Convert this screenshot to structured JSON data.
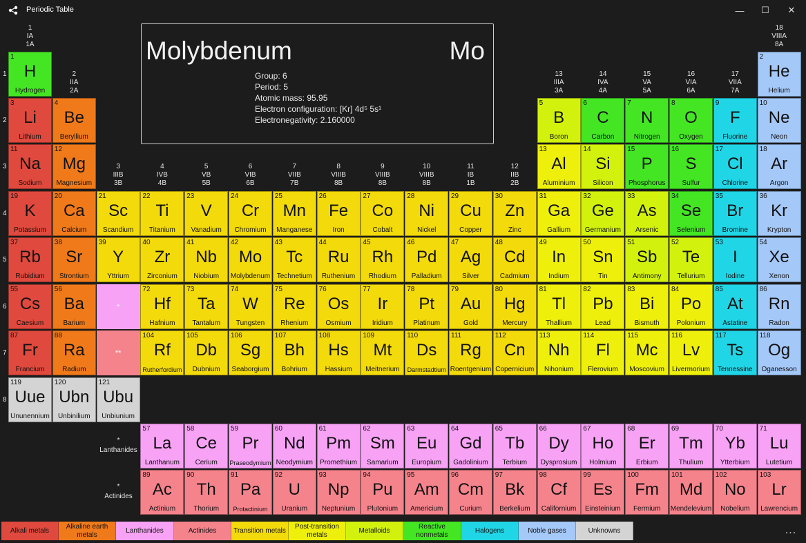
{
  "window": {
    "title": "Periodic Table",
    "minimize": "—",
    "maximize": "☐",
    "close": "✕",
    "icon": "share-nodes-icon"
  },
  "info": {
    "name": "Molybdenum",
    "symbol": "Mo",
    "lines": [
      "Group: 6",
      "Period: 5",
      "Atomic mass: 95.95",
      "Electron configuration: [Kr] 4d⁵ 5s¹",
      "Electronegativity: 2.160000"
    ]
  },
  "colors": {
    "alkali": "#e0493d",
    "alkaline": "#f07a1a",
    "lanthanide": "#f7a2f5",
    "actinide": "#f5838c",
    "transition": "#f3da0a",
    "post": "#eef00b",
    "metalloid": "#d2f20e",
    "nonmetal": "#44e624",
    "halogen": "#20d6e6",
    "noble": "#a4c8f8",
    "unknown": "#d4d4d4"
  },
  "group_headers": [
    [
      "1",
      "IA",
      "1A"
    ],
    [
      "2",
      "IIA",
      "2A"
    ],
    [
      "3",
      "IIIB",
      "3B"
    ],
    [
      "4",
      "IVB",
      "4B"
    ],
    [
      "5",
      "VB",
      "5B"
    ],
    [
      "6",
      "VIB",
      "6B"
    ],
    [
      "7",
      "VIIB",
      "7B"
    ],
    [
      "8",
      "VIIIB",
      "8B"
    ],
    [
      "9",
      "VIIIB",
      "8B"
    ],
    [
      "10",
      "VIIIB",
      "8B"
    ],
    [
      "11",
      "IB",
      "1B"
    ],
    [
      "12",
      "IIB",
      "2B"
    ],
    [
      "13",
      "IIIA",
      "3A"
    ],
    [
      "14",
      "IVA",
      "4A"
    ],
    [
      "15",
      "VA",
      "5A"
    ],
    [
      "16",
      "VIA",
      "6A"
    ],
    [
      "17",
      "VIIA",
      "7A"
    ],
    [
      "18",
      "VIIIA",
      "8A"
    ]
  ],
  "period_headers": [
    "1",
    "2",
    "3",
    "4",
    "5",
    "6",
    "7",
    "8"
  ],
  "series_labels": {
    "lanthanides": [
      "*",
      "Lanthanides"
    ],
    "actinides": [
      "*",
      "Actinides"
    ],
    "lan_marker": "*",
    "act_marker": "**"
  },
  "elements": [
    [
      1,
      "H",
      "Hydrogen",
      1,
      1,
      "nonmetal"
    ],
    [
      2,
      "He",
      "Helium",
      18,
      1,
      "noble"
    ],
    [
      3,
      "Li",
      "Lithium",
      1,
      2,
      "alkali"
    ],
    [
      4,
      "Be",
      "Beryllium",
      2,
      2,
      "alkaline"
    ],
    [
      5,
      "B",
      "Boron",
      13,
      2,
      "metalloid"
    ],
    [
      6,
      "C",
      "Carbon",
      14,
      2,
      "nonmetal"
    ],
    [
      7,
      "N",
      "Nitrogen",
      15,
      2,
      "nonmetal"
    ],
    [
      8,
      "O",
      "Oxygen",
      16,
      2,
      "nonmetal"
    ],
    [
      9,
      "F",
      "Fluorine",
      17,
      2,
      "halogen"
    ],
    [
      10,
      "Ne",
      "Neon",
      18,
      2,
      "noble"
    ],
    [
      11,
      "Na",
      "Sodium",
      1,
      3,
      "alkali"
    ],
    [
      12,
      "Mg",
      "Magnesium",
      2,
      3,
      "alkaline"
    ],
    [
      13,
      "Al",
      "Aluminium",
      13,
      3,
      "post"
    ],
    [
      14,
      "Si",
      "Silicon",
      14,
      3,
      "metalloid"
    ],
    [
      15,
      "P",
      "Phosphorus",
      15,
      3,
      "nonmetal"
    ],
    [
      16,
      "S",
      "Sulfur",
      16,
      3,
      "nonmetal"
    ],
    [
      17,
      "Cl",
      "Chlorine",
      17,
      3,
      "halogen"
    ],
    [
      18,
      "Ar",
      "Argon",
      18,
      3,
      "noble"
    ],
    [
      19,
      "K",
      "Potassium",
      1,
      4,
      "alkali"
    ],
    [
      20,
      "Ca",
      "Calcium",
      2,
      4,
      "alkaline"
    ],
    [
      21,
      "Sc",
      "Scandium",
      3,
      4,
      "transition"
    ],
    [
      22,
      "Ti",
      "Titanium",
      4,
      4,
      "transition"
    ],
    [
      23,
      "V",
      "Vanadium",
      5,
      4,
      "transition"
    ],
    [
      24,
      "Cr",
      "Chromium",
      6,
      4,
      "transition"
    ],
    [
      25,
      "Mn",
      "Manganese",
      7,
      4,
      "transition"
    ],
    [
      26,
      "Fe",
      "Iron",
      8,
      4,
      "transition"
    ],
    [
      27,
      "Co",
      "Cobalt",
      9,
      4,
      "transition"
    ],
    [
      28,
      "Ni",
      "Nickel",
      10,
      4,
      "transition"
    ],
    [
      29,
      "Cu",
      "Copper",
      11,
      4,
      "transition"
    ],
    [
      30,
      "Zn",
      "Zinc",
      12,
      4,
      "transition"
    ],
    [
      31,
      "Ga",
      "Gallium",
      13,
      4,
      "post"
    ],
    [
      32,
      "Ge",
      "Germanium",
      14,
      4,
      "metalloid"
    ],
    [
      33,
      "As",
      "Arsenic",
      15,
      4,
      "metalloid"
    ],
    [
      34,
      "Se",
      "Selenium",
      16,
      4,
      "nonmetal"
    ],
    [
      35,
      "Br",
      "Bromine",
      17,
      4,
      "halogen"
    ],
    [
      36,
      "Kr",
      "Krypton",
      18,
      4,
      "noble"
    ],
    [
      37,
      "Rb",
      "Rubidium",
      1,
      5,
      "alkali"
    ],
    [
      38,
      "Sr",
      "Strontium",
      2,
      5,
      "alkaline"
    ],
    [
      39,
      "Y",
      "Yttrium",
      3,
      5,
      "transition"
    ],
    [
      40,
      "Zr",
      "Zirconium",
      4,
      5,
      "transition"
    ],
    [
      41,
      "Nb",
      "Niobium",
      5,
      5,
      "transition"
    ],
    [
      42,
      "Mo",
      "Molybdenum",
      6,
      5,
      "transition"
    ],
    [
      43,
      "Tc",
      "Technetium",
      7,
      5,
      "transition"
    ],
    [
      44,
      "Ru",
      "Ruthenium",
      8,
      5,
      "transition"
    ],
    [
      45,
      "Rh",
      "Rhodium",
      9,
      5,
      "transition"
    ],
    [
      46,
      "Pd",
      "Palladium",
      10,
      5,
      "transition"
    ],
    [
      47,
      "Ag",
      "Silver",
      11,
      5,
      "transition"
    ],
    [
      48,
      "Cd",
      "Cadmium",
      12,
      5,
      "transition"
    ],
    [
      49,
      "In",
      "Indium",
      13,
      5,
      "post"
    ],
    [
      50,
      "Sn",
      "Tin",
      14,
      5,
      "post"
    ],
    [
      51,
      "Sb",
      "Antimony",
      15,
      5,
      "metalloid"
    ],
    [
      52,
      "Te",
      "Tellurium",
      16,
      5,
      "metalloid"
    ],
    [
      53,
      "I",
      "Iodine",
      17,
      5,
      "halogen"
    ],
    [
      54,
      "Xe",
      "Xenon",
      18,
      5,
      "noble"
    ],
    [
      55,
      "Cs",
      "Caesium",
      1,
      6,
      "alkali"
    ],
    [
      56,
      "Ba",
      "Barium",
      2,
      6,
      "alkaline"
    ],
    [
      72,
      "Hf",
      "Hafnium",
      4,
      6,
      "transition"
    ],
    [
      73,
      "Ta",
      "Tantalum",
      5,
      6,
      "transition"
    ],
    [
      74,
      "W",
      "Tungsten",
      6,
      6,
      "transition"
    ],
    [
      75,
      "Re",
      "Rhenium",
      7,
      6,
      "transition"
    ],
    [
      76,
      "Os",
      "Osmium",
      8,
      6,
      "transition"
    ],
    [
      77,
      "Ir",
      "Iridium",
      9,
      6,
      "transition"
    ],
    [
      78,
      "Pt",
      "Platinum",
      10,
      6,
      "transition"
    ],
    [
      79,
      "Au",
      "Gold",
      11,
      6,
      "transition"
    ],
    [
      80,
      "Hg",
      "Mercury",
      12,
      6,
      "transition"
    ],
    [
      81,
      "Tl",
      "Thallium",
      13,
      6,
      "post"
    ],
    [
      82,
      "Pb",
      "Lead",
      14,
      6,
      "post"
    ],
    [
      83,
      "Bi",
      "Bismuth",
      15,
      6,
      "post"
    ],
    [
      84,
      "Po",
      "Polonium",
      16,
      6,
      "post"
    ],
    [
      85,
      "At",
      "Astatine",
      17,
      6,
      "halogen"
    ],
    [
      86,
      "Rn",
      "Radon",
      18,
      6,
      "noble"
    ],
    [
      87,
      "Fr",
      "Francium",
      1,
      7,
      "alkali"
    ],
    [
      88,
      "Ra",
      "Radium",
      2,
      7,
      "alkaline"
    ],
    [
      104,
      "Rf",
      "Rutherfordium",
      4,
      7,
      "transition"
    ],
    [
      105,
      "Db",
      "Dubnium",
      5,
      7,
      "transition"
    ],
    [
      106,
      "Sg",
      "Seaborgium",
      6,
      7,
      "transition"
    ],
    [
      107,
      "Bh",
      "Bohrium",
      7,
      7,
      "transition"
    ],
    [
      108,
      "Hs",
      "Hassium",
      8,
      7,
      "transition"
    ],
    [
      109,
      "Mt",
      "Meitnerium",
      9,
      7,
      "transition"
    ],
    [
      110,
      "Ds",
      "Darmstadtium",
      10,
      7,
      "transition"
    ],
    [
      111,
      "Rg",
      "Roentgenium",
      11,
      7,
      "transition"
    ],
    [
      112,
      "Cn",
      "Copernicium",
      12,
      7,
      "transition"
    ],
    [
      113,
      "Nh",
      "Nihonium",
      13,
      7,
      "post"
    ],
    [
      114,
      "Fl",
      "Flerovium",
      14,
      7,
      "post"
    ],
    [
      115,
      "Mc",
      "Moscovium",
      15,
      7,
      "post"
    ],
    [
      116,
      "Lv",
      "Livermorium",
      16,
      7,
      "post"
    ],
    [
      117,
      "Ts",
      "Tennessine",
      17,
      7,
      "halogen"
    ],
    [
      118,
      "Og",
      "Oganesson",
      18,
      7,
      "noble"
    ],
    [
      119,
      "Uue",
      "Ununennium",
      1,
      8,
      "unknown"
    ],
    [
      120,
      "Ubn",
      "Unbinilium",
      2,
      8,
      "unknown"
    ],
    [
      121,
      "Ubu",
      "Unbiunium",
      3,
      8,
      "unknown"
    ],
    [
      57,
      "La",
      "Lanthanum",
      4,
      9,
      "lanthanide"
    ],
    [
      58,
      "Ce",
      "Cerium",
      5,
      9,
      "lanthanide"
    ],
    [
      59,
      "Pr",
      "Praseodymium",
      6,
      9,
      "lanthanide"
    ],
    [
      60,
      "Nd",
      "Neodymium",
      7,
      9,
      "lanthanide"
    ],
    [
      61,
      "Pm",
      "Promethium",
      8,
      9,
      "lanthanide"
    ],
    [
      62,
      "Sm",
      "Samarium",
      9,
      9,
      "lanthanide"
    ],
    [
      63,
      "Eu",
      "Europium",
      10,
      9,
      "lanthanide"
    ],
    [
      64,
      "Gd",
      "Gadolinium",
      11,
      9,
      "lanthanide"
    ],
    [
      65,
      "Tb",
      "Terbium",
      12,
      9,
      "lanthanide"
    ],
    [
      66,
      "Dy",
      "Dysprosium",
      13,
      9,
      "lanthanide"
    ],
    [
      67,
      "Ho",
      "Holmium",
      14,
      9,
      "lanthanide"
    ],
    [
      68,
      "Er",
      "Erbium",
      15,
      9,
      "lanthanide"
    ],
    [
      69,
      "Tm",
      "Thulium",
      16,
      9,
      "lanthanide"
    ],
    [
      70,
      "Yb",
      "Ytterbium",
      17,
      9,
      "lanthanide"
    ],
    [
      71,
      "Lu",
      "Lutetium",
      18,
      9,
      "lanthanide"
    ],
    [
      89,
      "Ac",
      "Actinium",
      4,
      10,
      "actinide"
    ],
    [
      90,
      "Th",
      "Thorium",
      5,
      10,
      "actinide"
    ],
    [
      91,
      "Pa",
      "Protactinium",
      6,
      10,
      "actinide"
    ],
    [
      92,
      "U",
      "Uranium",
      7,
      10,
      "actinide"
    ],
    [
      93,
      "Np",
      "Neptunium",
      8,
      10,
      "actinide"
    ],
    [
      94,
      "Pu",
      "Plutonium",
      9,
      10,
      "actinide"
    ],
    [
      95,
      "Am",
      "Americium",
      10,
      10,
      "actinide"
    ],
    [
      96,
      "Cm",
      "Curium",
      11,
      10,
      "actinide"
    ],
    [
      97,
      "Bk",
      "Berkelium",
      12,
      10,
      "actinide"
    ],
    [
      98,
      "Cf",
      "Californium",
      13,
      10,
      "actinide"
    ],
    [
      99,
      "Es",
      "Einsteinium",
      14,
      10,
      "actinide"
    ],
    [
      100,
      "Fm",
      "Fermium",
      15,
      10,
      "actinide"
    ],
    [
      101,
      "Md",
      "Mendelevium",
      16,
      10,
      "actinide"
    ],
    [
      102,
      "No",
      "Nobelium",
      17,
      10,
      "actinide"
    ],
    [
      103,
      "Lr",
      "Lawrencium",
      18,
      10,
      "actinide"
    ]
  ],
  "legend": [
    [
      "Alkali metals",
      "alkali"
    ],
    [
      "Alkaline earth metals",
      "alkaline"
    ],
    [
      "Lanthanides",
      "lanthanide"
    ],
    [
      "Actinides",
      "actinide"
    ],
    [
      "Transition metals",
      "transition"
    ],
    [
      "Post-transition metals",
      "post"
    ],
    [
      "Metalloids",
      "metalloid"
    ],
    [
      "Reactive nonmetals",
      "nonmetal"
    ],
    [
      "Halogens",
      "halogen"
    ],
    [
      "Noble gases",
      "noble"
    ],
    [
      "Unknowns",
      "unknown"
    ]
  ],
  "more": "..."
}
